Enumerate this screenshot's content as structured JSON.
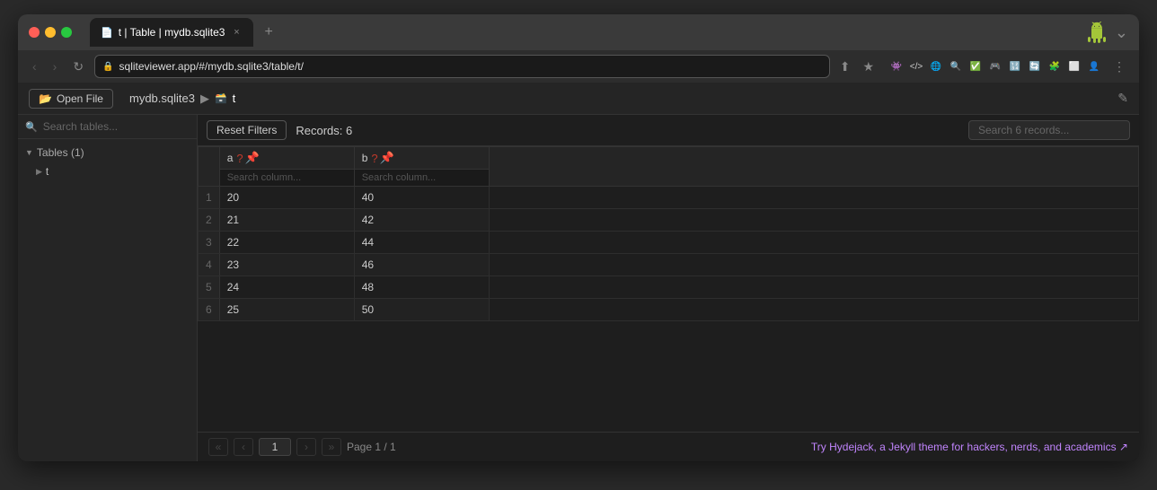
{
  "browser": {
    "tab": {
      "icon": "📄",
      "label": "t | Table | mydb.sqlite3",
      "close": "×"
    },
    "new_tab": "+",
    "address": "sqliteviewer.app/#/mydb.sqlite3/table/t/",
    "window_collapse": "⌄"
  },
  "nav": {
    "back": "‹",
    "forward": "›",
    "refresh": "↻",
    "actions": [
      "⬆",
      "☐",
      "⬆",
      "★"
    ]
  },
  "app": {
    "toolbar": {
      "open_file_btn": "Open File",
      "breadcrumb": {
        "db": "mydb.sqlite3",
        "separator": "▶",
        "table": "t"
      },
      "edit_icon": "✎"
    },
    "sidebar": {
      "search_placeholder": "Search tables...",
      "section_label": "Tables (1)",
      "table_item": "t"
    },
    "table_controls": {
      "reset_filters_label": "Reset Filters",
      "records_count": "Records: 6",
      "search_placeholder": "Search 6 records..."
    },
    "columns": [
      {
        "name": "a",
        "search_placeholder": "Search column..."
      },
      {
        "name": "b",
        "search_placeholder": "Search column..."
      }
    ],
    "rows": [
      {
        "num": "1",
        "a": "20",
        "b": "40"
      },
      {
        "num": "2",
        "a": "21",
        "b": "42"
      },
      {
        "num": "3",
        "a": "22",
        "b": "44"
      },
      {
        "num": "4",
        "a": "23",
        "b": "46"
      },
      {
        "num": "5",
        "a": "24",
        "b": "48"
      },
      {
        "num": "6",
        "a": "25",
        "b": "50"
      }
    ],
    "pagination": {
      "first": "«",
      "prev": "‹",
      "page_value": "1",
      "next": "›",
      "last": "»",
      "page_info": "Page 1 / 1"
    },
    "hydejack": {
      "text": "Try Hydejack, a Jekyll theme for hackers, nerds, and academics ↗"
    }
  }
}
